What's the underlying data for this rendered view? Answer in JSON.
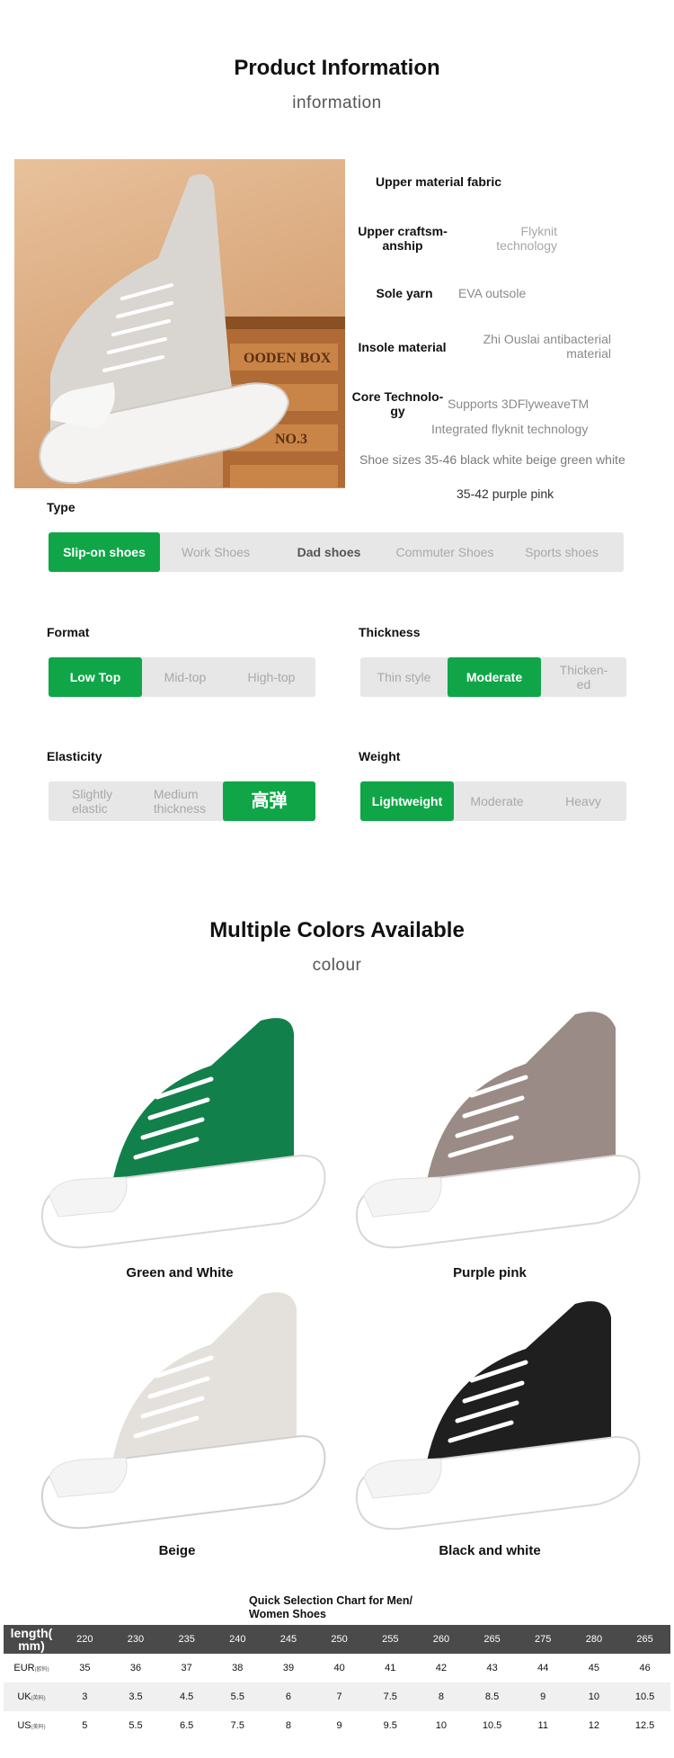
{
  "product_info": {
    "title": "Product Information",
    "subtitle": "information",
    "specs": [
      {
        "label": "Upper material fabric",
        "value": ""
      },
      {
        "label": "Upper craftsm-\nanship",
        "value": "Flyknit\ntechnology"
      },
      {
        "label": "Sole yarn",
        "value": "EVA outsole"
      },
      {
        "label": "Insole material",
        "value": "Zhi Ouslai antibacterial\nmaterial"
      },
      {
        "label": "Core Technolo-\ngy",
        "value": "Supports 3DFlyweaveTM",
        "value2": "Integrated flyknit technology"
      }
    ],
    "sizes_line1": "Shoe sizes 35-46 black white beige green white",
    "sizes_line2": "35-42 purple pink"
  },
  "attributes": {
    "type": {
      "label": "Type",
      "options": [
        "Slip-on shoes",
        "Work Shoes",
        "Dad shoes",
        "Commuter Shoes",
        "Sports shoes"
      ],
      "selected": "Slip-on shoes"
    },
    "format": {
      "label": "Format",
      "options": [
        "Low Top",
        "Mid-top",
        "High-top"
      ],
      "selected": "Low Top"
    },
    "thickness": {
      "label": "Thickness",
      "options": [
        "Thin style",
        "Moderate",
        "Thicken-\ned"
      ],
      "selected": "Moderate"
    },
    "elasticity": {
      "label": "Elasticity",
      "options": [
        "Slightly\nelastic",
        "Medium\nthickness",
        "高弹"
      ],
      "selected": "高弹"
    },
    "weight": {
      "label": "Weight",
      "options": [
        "Lightweight",
        "Moderate",
        "Heavy"
      ],
      "selected": "Lightweight"
    }
  },
  "colors": {
    "title": "Multiple Colors Available",
    "subtitle": "colour",
    "items": [
      {
        "name": "Green and White",
        "knit": "#12804b"
      },
      {
        "name": "Purple pink",
        "knit": "#9a8b86"
      },
      {
        "name": "Beige",
        "knit": "#e4e1dc"
      },
      {
        "name": "Black and white",
        "knit": "#1f1f1f"
      }
    ]
  },
  "size_chart": {
    "title": "Quick Selection Chart for Men/\nWomen Shoes",
    "header": [
      "length(\nmm)",
      "220",
      "230",
      "235",
      "240",
      "245",
      "250",
      "255",
      "260",
      "265",
      "275",
      "280",
      "265"
    ],
    "rows": [
      {
        "label": "EUR",
        "sub": "(欧码)",
        "values": [
          "35",
          "36",
          "37",
          "38",
          "39",
          "40",
          "41",
          "42",
          "43",
          "44",
          "45",
          "46"
        ]
      },
      {
        "label": "UK",
        "sub": "(英码)",
        "values": [
          "3",
          "3.5",
          "4.5",
          "5.5",
          "6",
          "7",
          "7.5",
          "8",
          "8.5",
          "9",
          "10",
          "10.5"
        ]
      },
      {
        "label": "US",
        "sub": "(美码)",
        "values": [
          "5",
          "5.5",
          "6.5",
          "7.5",
          "8",
          "9",
          "9.5",
          "10",
          "10.5",
          "11",
          "12",
          "12.5"
        ]
      }
    ]
  }
}
